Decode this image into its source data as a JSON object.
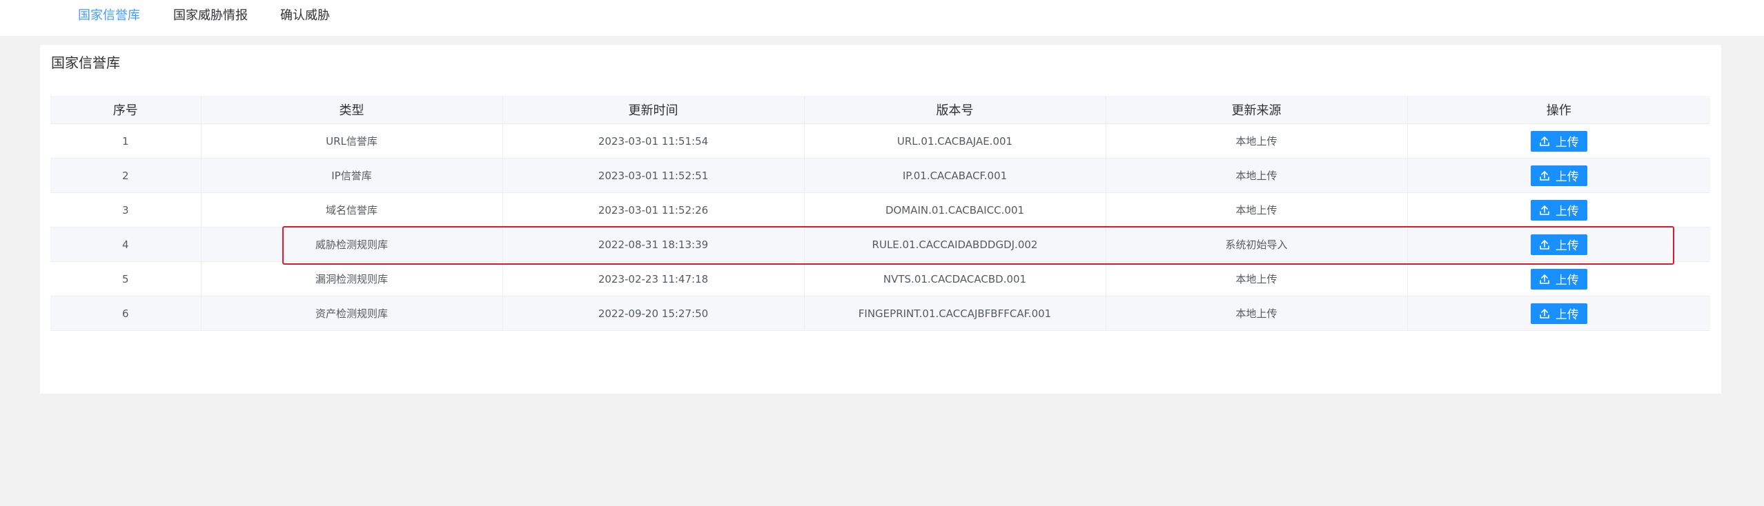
{
  "tabs": [
    {
      "label": "国家信誉库",
      "active": true
    },
    {
      "label": "国家威胁情报",
      "active": false
    },
    {
      "label": "确认威胁",
      "active": false
    }
  ],
  "panel": {
    "title": "国家信誉库"
  },
  "table": {
    "headers": [
      "序号",
      "类型",
      "更新时间",
      "版本号",
      "更新来源",
      "操作"
    ],
    "rows": [
      {
        "index": "1",
        "type": "URL信誉库",
        "time": "2023-03-01 11:51:54",
        "version": "URL.01.CACBAJAE.001",
        "source": "本地上传",
        "action": "上传"
      },
      {
        "index": "2",
        "type": "IP信誉库",
        "time": "2023-03-01 11:52:51",
        "version": "IP.01.CACABACF.001",
        "source": "本地上传",
        "action": "上传"
      },
      {
        "index": "3",
        "type": "域名信誉库",
        "time": "2023-03-01 11:52:26",
        "version": "DOMAIN.01.CACBAICC.001",
        "source": "本地上传",
        "action": "上传"
      },
      {
        "index": "4",
        "type": "威胁检测规则库",
        "time": "2022-08-31 18:13:39",
        "version": "RULE.01.CACCAIDABDDGDJ.002",
        "source": "系统初始导入",
        "action": "上传"
      },
      {
        "index": "5",
        "type": "漏洞检测规则库",
        "time": "2023-02-23 11:47:18",
        "version": "NVTS.01.CACDACACBD.001",
        "source": "本地上传",
        "action": "上传"
      },
      {
        "index": "6",
        "type": "资产检测规则库",
        "time": "2022-09-20 15:27:50",
        "version": "FINGEPRINT.01.CACCAJBFBFFCAF.001",
        "source": "本地上传",
        "action": "上传"
      }
    ]
  },
  "colors": {
    "accent": "#409eff",
    "button": "#1890ff",
    "highlight": "#e0192a"
  },
  "icons": {
    "upload": "upload-icon"
  }
}
